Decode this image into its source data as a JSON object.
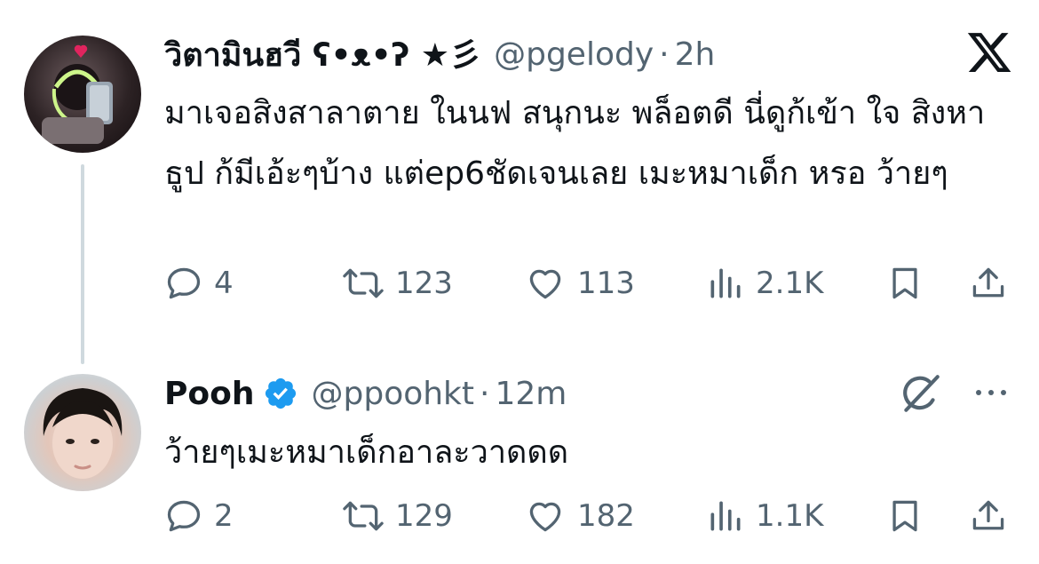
{
  "tweets": [
    {
      "display_name": "วิตามินฮวี ʕ•ᴥ•ʔ ★彡",
      "handle": "@pgelody",
      "separator": "·",
      "time": "2h",
      "text": "มาเจอสิงสาลาตาย ในนฟ สนุกนะ พล็อตดี นี่ดูก้เข้า ใจ สิงหาธูป ก้มีเอ้ะๆบ้าง แต่ep6ชัดเจนเลย เมะหมาเด็ก หรอ ว้ายๆ",
      "stats": {
        "replies": "4",
        "reposts": "123",
        "likes": "113",
        "views": "2.1K"
      }
    },
    {
      "display_name": "Pooh",
      "handle": "@ppoohkt",
      "separator": "·",
      "time": "12m",
      "text": "ว้ายๆเมะหมาเด็กอาละวาดดด",
      "stats": {
        "replies": "2",
        "reposts": "129",
        "likes": "182",
        "views": "1.1K"
      }
    }
  ],
  "colors": {
    "text": "#0f1419",
    "secondary": "#536471",
    "verified": "#1d9bf0",
    "thread_line": "#cfd9de"
  },
  "icons": [
    "x-logo-icon",
    "verified-badge-icon",
    "reply-icon",
    "repost-icon",
    "like-icon",
    "views-icon",
    "bookmark-icon",
    "share-icon",
    "grok-icon",
    "more-icon"
  ]
}
